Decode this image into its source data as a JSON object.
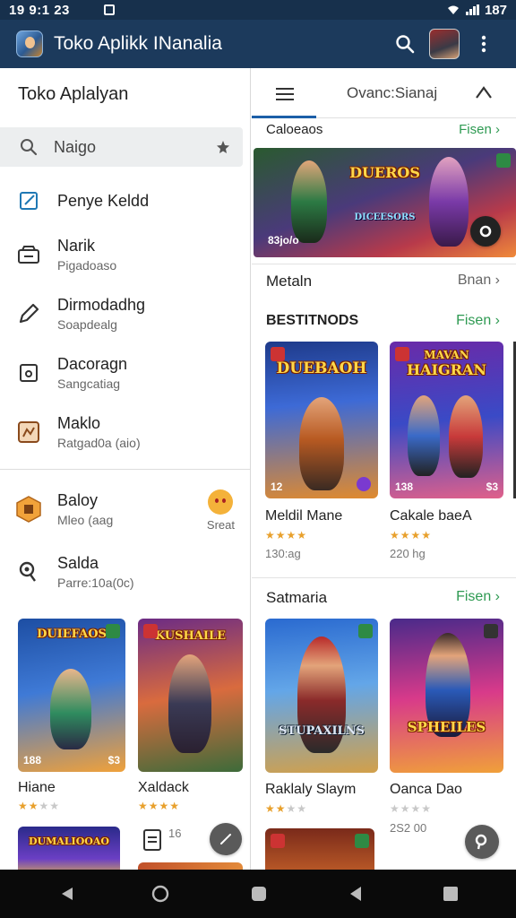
{
  "status_bar": {
    "time": "19 9:1 23",
    "battery": "187"
  },
  "app_bar": {
    "title": "Toko Aplikk INanalia"
  },
  "drawer": {
    "title": "Toko Aplalyan",
    "search_placeholder": "Naigo",
    "items": [
      {
        "label": "Penye Keldd",
        "sub": "",
        "icon": "external-link-icon"
      },
      {
        "label": "Narik",
        "sub": "Pigadoaso",
        "icon": "inbox-icon"
      },
      {
        "label": "Dirmodadhg",
        "sub": "Soapdealg",
        "icon": "pencil-icon"
      },
      {
        "label": "Dacoragn",
        "sub": "Sangcatiag",
        "icon": "square-dot-icon"
      },
      {
        "label": "Maklo",
        "sub": "Ratgad0a (aio)",
        "icon": "game-icon"
      }
    ],
    "extra_items": [
      {
        "label": "Baloy",
        "sub": "Mleo (aag",
        "icon": "badge-icon",
        "side_label": "Sreat"
      },
      {
        "label": "Salda",
        "sub": "Parre:10a(0c)",
        "icon": "key-icon"
      }
    ],
    "cards": [
      {
        "title": "Hiane",
        "rating": 2,
        "art_text": "DUIEFAOS",
        "corner_l": "188",
        "corner_r": "$3"
      },
      {
        "title": "Xaldack",
        "rating": 4,
        "art_text": "KUSHAILE",
        "corner_l": "",
        "corner_r": ""
      }
    ],
    "bottom_cards": [
      {
        "art_text": "DUMALIOOAO",
        "meta": ""
      },
      {
        "art_text": "",
        "meta": "16"
      }
    ]
  },
  "main": {
    "tabs": {
      "active_index": 0,
      "label": "Ovanc:Sianaj"
    },
    "banner": {
      "section_title": "Caloeaos",
      "link": "Fisen",
      "art_text": "DUEROS",
      "art_sub": "DICEESORS",
      "corner_l": "83jo/o"
    },
    "section_metaln": {
      "title": "Metaln",
      "link": "Bnan"
    },
    "section_best": {
      "title": "BESTITNODS",
      "link": "Fisen"
    },
    "best_cards": [
      {
        "title": "Meldil Mane",
        "rating": 4,
        "meta": "130:ag",
        "art_text": "DUEBAOH",
        "corner_l": "12",
        "corner_r": ""
      },
      {
        "title": "Cakale baeA",
        "rating": 4,
        "meta": "220 hg",
        "art_text": "HAIGRAN",
        "art_top": "MAVAN",
        "corner_l": "138",
        "corner_r": "$3"
      }
    ],
    "section_samaria": {
      "title": "Satmaria",
      "link": "Fisen"
    },
    "samaria_cards": [
      {
        "title": "Raklaly Slaym",
        "rating": 2,
        "meta": "",
        "art_text": "STUPAXILNS",
        "corner_l": "",
        "corner_r": ""
      },
      {
        "title": "Oanca Dao",
        "rating": 0,
        "meta": "2S2 00",
        "art_text": "SPHEILES",
        "corner_l": "",
        "corner_r": ""
      }
    ]
  },
  "colors": {
    "appbar": "#1c3a5c",
    "status": "#17304c",
    "accent_green": "#2e9a52",
    "tab_indicator": "#1c5fa8"
  }
}
